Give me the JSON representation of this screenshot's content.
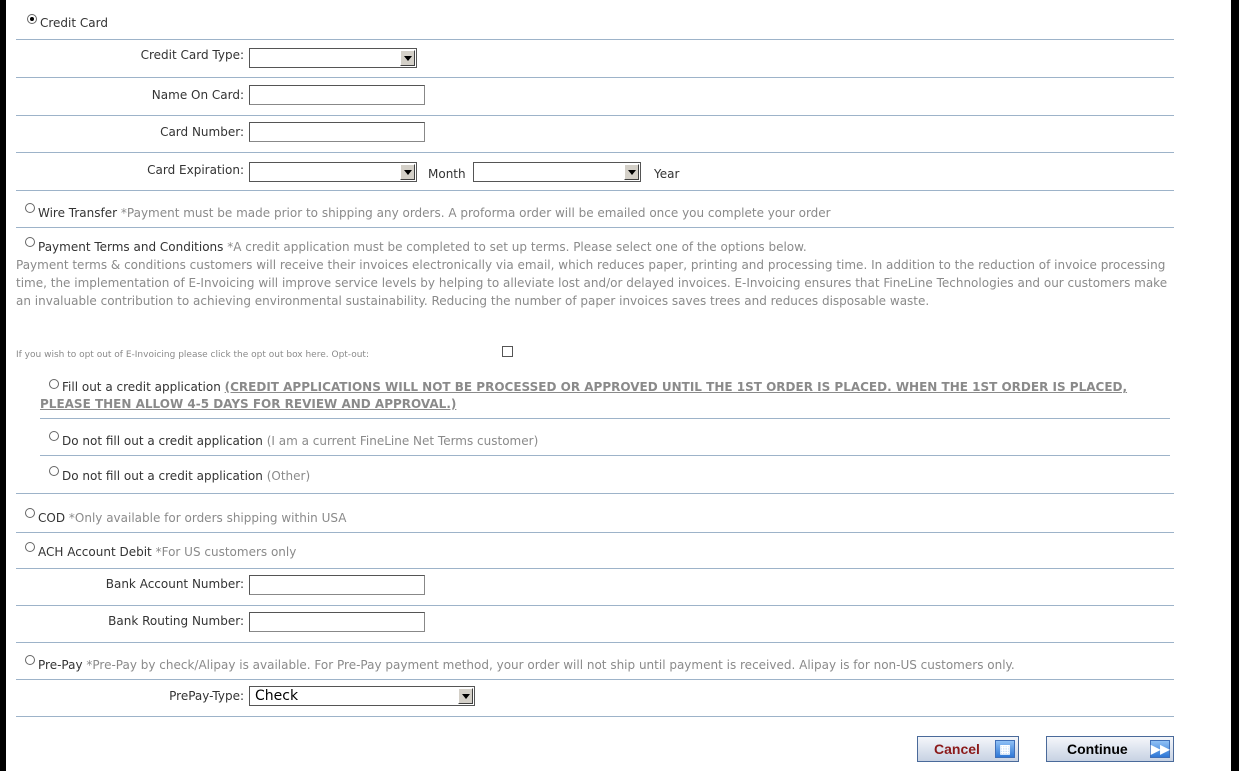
{
  "credit_card": {
    "label": "Credit Card",
    "type_label": "Credit Card Type:",
    "type_value": "",
    "name_label": "Name On Card:",
    "number_label": "Card Number:",
    "expiration_label": "Card Expiration:",
    "month_value": "",
    "month_label": "Month",
    "year_value": "",
    "year_label": "Year"
  },
  "wire": {
    "label": "Wire Transfer",
    "note": "*Payment must be made prior to shipping any orders. A proforma order will be emailed once you complete your order"
  },
  "terms": {
    "label": "Payment Terms and Conditions",
    "note": "*A credit application must be completed to set up terms. Please select one of the options below.",
    "paragraph": "Payment terms & conditions customers will receive their invoices electronically via email, which reduces paper, printing and processing time. In addition to the reduction of invoice processing time, the implementation of E-Invoicing will improve service levels by helping to alleviate lost and/or delayed invoices. E-Invoicing ensures that FineLine Technologies and our customers make an invaluable contribution to achieving environmental sustainability. Reducing the number of paper invoices saves trees and reduces disposable waste.",
    "optout_text": "If you wish to opt out of E-Invoicing please click the opt out box here. Opt-out:",
    "optout_checked": false,
    "option_fill_label": "Fill out a credit application",
    "option_fill_warning": "(CREDIT APPLICATIONS WILL NOT BE PROCESSED OR APPROVED UNTIL THE 1ST ORDER IS PLACED. WHEN THE 1ST ORDER IS PLACED, PLEASE THEN ALLOW 4-5 DAYS FOR REVIEW AND APPROVAL.)",
    "option_current_label": "Do not fill out a credit application",
    "option_current_note": "(I am a current FineLine Net Terms customer)",
    "option_other_label": "Do not fill out a credit application",
    "option_other_note": "(Other)"
  },
  "cod": {
    "label": "COD",
    "note": "*Only available for orders shipping within USA"
  },
  "ach": {
    "label": "ACH Account Debit",
    "note": "*For US customers only",
    "account_label": "Bank Account Number:",
    "routing_label": "Bank Routing Number:"
  },
  "prepay": {
    "label": "Pre-Pay",
    "note": "*Pre-Pay by check/Alipay is available. For Pre-Pay payment method, your order will not ship until payment is received. Alipay is for non-US customers only.",
    "type_label": "PrePay-Type:",
    "type_value": "Check"
  },
  "buttons": {
    "cancel": "Cancel",
    "continue": "Continue"
  },
  "colors": {
    "divider": "#9db3c9",
    "cancel_text": "#8b1a1a",
    "continue_text": "#000000"
  }
}
